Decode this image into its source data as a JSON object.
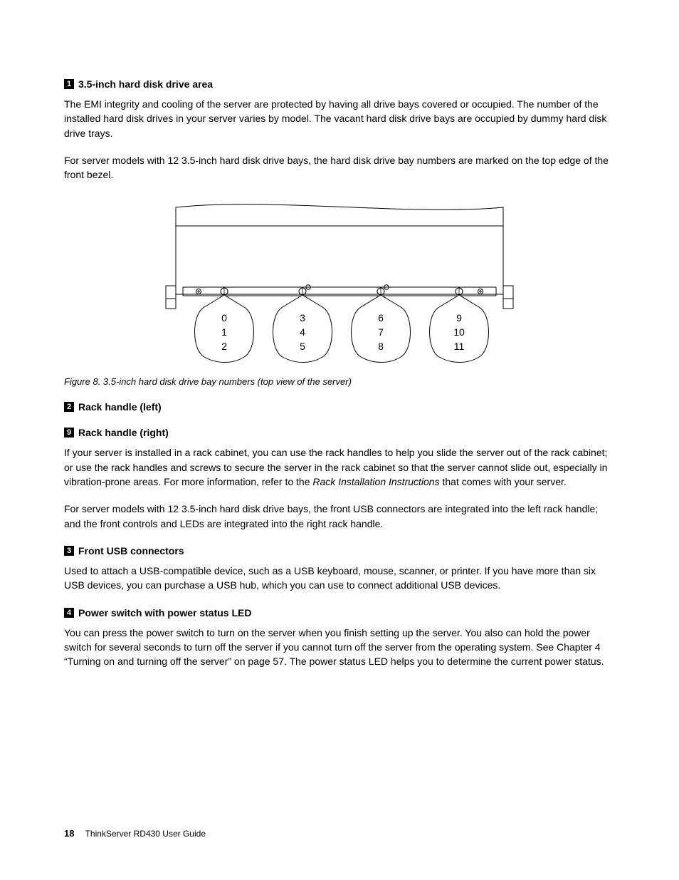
{
  "sections": {
    "hdd_area": {
      "num": "1",
      "title": "3.5-inch hard disk drive area",
      "p1": "The EMI integrity and cooling of the server are protected by having all drive bays covered or occupied. The number of the installed hard disk drives in your server varies by model. The vacant hard disk drive bays are occupied by dummy hard disk drive trays.",
      "p2": "For server models with 12 3.5-inch hard disk drive bays, the hard disk drive bay numbers are marked on the top edge of the front bezel."
    },
    "figure": {
      "caption": "Figure 8. 3.5-inch hard disk drive bay numbers (top view of the server)",
      "bays": [
        [
          "0",
          "1",
          "2"
        ],
        [
          "3",
          "4",
          "5"
        ],
        [
          "6",
          "7",
          "8"
        ],
        [
          "9",
          "10",
          "11"
        ]
      ]
    },
    "rack_left": {
      "num": "2",
      "title": "Rack handle (left)"
    },
    "rack_right": {
      "num": "9",
      "title": "Rack handle (right)"
    },
    "rack_desc": {
      "p1a": "If your server is installed in a rack cabinet, you can use the rack handles to help you slide the server out of the rack cabinet; or use the rack handles and screws to secure the server in the rack cabinet so that the server cannot slide out, especially in vibration-prone areas. For more information, refer to the ",
      "p1_ref": "Rack Installation Instructions",
      "p1b": " that comes with your server.",
      "p2": "For server models with 12 3.5-inch hard disk drive bays, the front USB connectors are integrated into the left rack handle; and the front controls and LEDs are integrated into the right rack handle."
    },
    "usb": {
      "num": "3",
      "title": "Front USB connectors",
      "p1": "Used to attach a USB-compatible device, such as a USB keyboard, mouse, scanner, or printer. If you have more than six USB devices, you can purchase a USB hub, which you can use to connect additional USB devices."
    },
    "power": {
      "num": "4",
      "title": "Power switch with power status LED",
      "p1": "You can press the power switch to turn on the server when you finish setting up the server. You also can hold the power switch for several seconds to turn off the server if you cannot turn off the server from the operating system. See Chapter 4 “Turning on and turning off the server” on page 57. The power status LED helps you to determine the current power status."
    }
  },
  "footer": {
    "page_num": "18",
    "doc_title": "ThinkServer RD430 User Guide"
  }
}
